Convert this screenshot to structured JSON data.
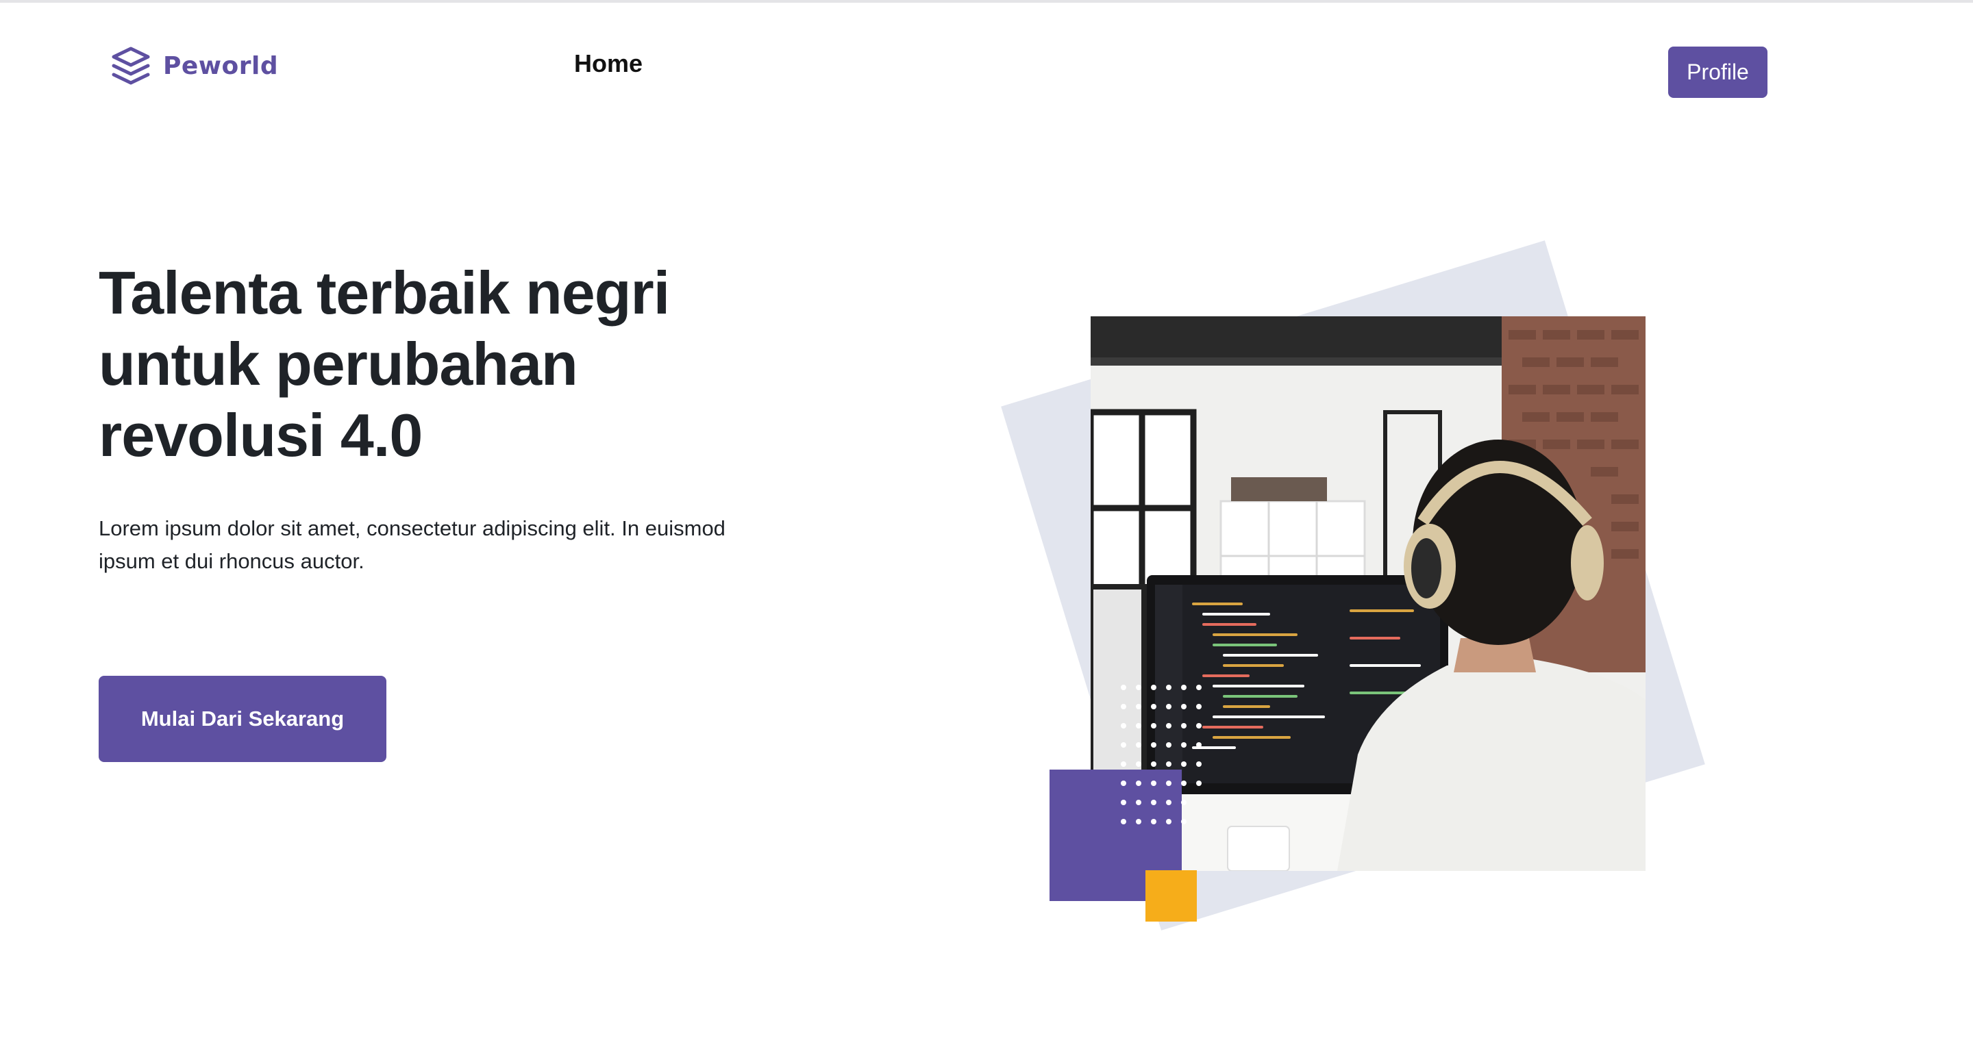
{
  "nav": {
    "brand": "Peworld",
    "brand_icon": "layers-icon",
    "home_label": "Home",
    "profile_label": "Profile"
  },
  "hero": {
    "title_line1": "Talenta terbaik negri",
    "title_line2": "untuk perubahan",
    "title_line3": "revolusi 4.0",
    "description_line1": "Lorem ipsum dolor sit amet, consectetur adipiscing elit. In euismod",
    "description_line2": "ipsum et dui rhoncus auctor.",
    "cta_label": "Mulai Dari Sekarang",
    "image": "developer-with-headphones-at-computer"
  },
  "colors": {
    "brand": "#5e50a1",
    "accent_yellow": "#f6ad1a",
    "deco_gray": "#e2e5ee",
    "text_dark": "#1f2328"
  }
}
